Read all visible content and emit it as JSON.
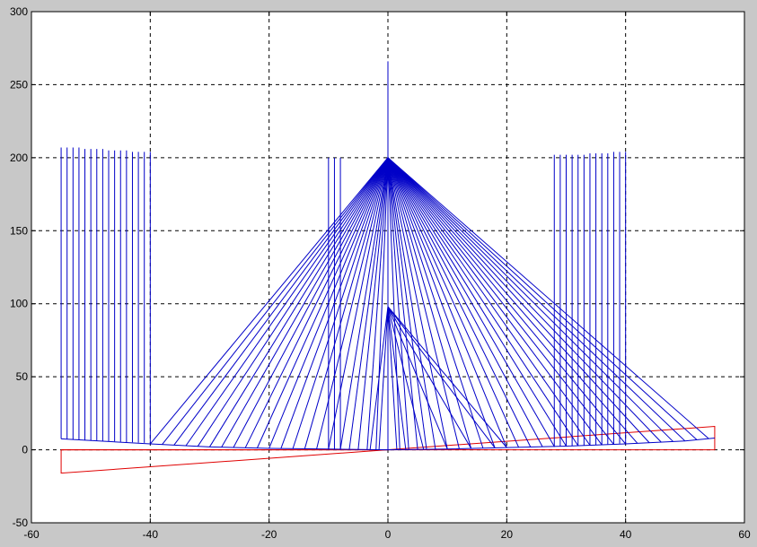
{
  "chart_data": {
    "type": "line",
    "title": "",
    "xlabel": "",
    "ylabel": "",
    "xlim": [
      -60,
      60
    ],
    "ylim": [
      -50,
      300
    ],
    "grid": true,
    "x_ticks": [
      -60,
      -40,
      -20,
      0,
      20,
      40,
      60
    ],
    "y_ticks": [
      -50,
      0,
      50,
      100,
      150,
      200,
      250,
      300
    ],
    "x_tick_labels": [
      "-60",
      "-40",
      "-20",
      "0",
      "20",
      "40",
      "60"
    ],
    "y_tick_labels": [
      "-50",
      "0",
      "50",
      "100",
      "150",
      "200",
      "250",
      "300"
    ],
    "colors": {
      "cables": "#0000c8",
      "outline": "#e00000",
      "axes_bg": "#ffffff",
      "figure_bg": "#c8c8c8"
    },
    "series": [
      {
        "color": "#0000c8",
        "tower": {
          "x": 0,
          "y_bottom": 0,
          "y_top": 266
        },
        "anchor": {
          "x": 0,
          "y": 200
        },
        "secondary_anchor": {
          "x": 0,
          "y": 98
        },
        "left_fan_x": [
          -40,
          -38,
          -36,
          -34,
          -32,
          -30,
          -28,
          -26,
          -24,
          -22,
          -20,
          -18,
          -16,
          -14,
          -12,
          -10,
          -8,
          -6.5,
          -5,
          -3.5,
          -2
        ],
        "right_fan_x": [
          2,
          3.5,
          5,
          6.5,
          8,
          10,
          12,
          14,
          16,
          18,
          20,
          22,
          24,
          26,
          28,
          30,
          32,
          34,
          36,
          38,
          40,
          42,
          44,
          46,
          48,
          50,
          52,
          54
        ],
        "secondary_fan_x": [
          -3,
          -1.5,
          1.5,
          3,
          6,
          10,
          14,
          18,
          20
        ],
        "left_hangers": [
          {
            "x": -55,
            "y_bottom": 7.5,
            "y_top": 207
          },
          {
            "x": -54,
            "y_bottom": 7.3,
            "y_top": 207
          },
          {
            "x": -53,
            "y_bottom": 7.1,
            "y_top": 207
          },
          {
            "x": -52,
            "y_bottom": 6.9,
            "y_top": 207
          },
          {
            "x": -51,
            "y_bottom": 6.7,
            "y_top": 206
          },
          {
            "x": -50,
            "y_bottom": 6.5,
            "y_top": 206
          },
          {
            "x": -49,
            "y_bottom": 6.3,
            "y_top": 206
          },
          {
            "x": -48,
            "y_bottom": 6.1,
            "y_top": 206
          },
          {
            "x": -47,
            "y_bottom": 5.9,
            "y_top": 205
          },
          {
            "x": -46,
            "y_bottom": 5.7,
            "y_top": 205
          },
          {
            "x": -45,
            "y_bottom": 5.5,
            "y_top": 205
          },
          {
            "x": -44,
            "y_bottom": 5.3,
            "y_top": 205
          },
          {
            "x": -43,
            "y_bottom": 5.1,
            "y_top": 204
          },
          {
            "x": -42,
            "y_bottom": 4.9,
            "y_top": 204
          },
          {
            "x": -41,
            "y_bottom": 4.7,
            "y_top": 204
          },
          {
            "x": -40,
            "y_bottom": 4.5,
            "y_top": 204
          }
        ],
        "mid_hangers": [
          {
            "x": -10,
            "y_bottom": 0,
            "y_top": 200
          },
          {
            "x": -9,
            "y_bottom": 0,
            "y_top": 200
          },
          {
            "x": -8,
            "y_bottom": 0,
            "y_top": 200
          }
        ],
        "right_hangers": [
          {
            "x": 28,
            "y_bottom": 2,
            "y_top": 202
          },
          {
            "x": 29,
            "y_bottom": 2.2,
            "y_top": 202
          },
          {
            "x": 30,
            "y_bottom": 2.4,
            "y_top": 202
          },
          {
            "x": 31,
            "y_bottom": 2.6,
            "y_top": 202
          },
          {
            "x": 32,
            "y_bottom": 2.8,
            "y_top": 202
          },
          {
            "x": 33,
            "y_bottom": 3.0,
            "y_top": 202
          },
          {
            "x": 34,
            "y_bottom": 3.2,
            "y_top": 203
          },
          {
            "x": 35,
            "y_bottom": 3.4,
            "y_top": 203
          },
          {
            "x": 36,
            "y_bottom": 3.6,
            "y_top": 203
          },
          {
            "x": 37,
            "y_bottom": 3.8,
            "y_top": 203
          },
          {
            "x": 38,
            "y_bottom": 4.0,
            "y_top": 204
          },
          {
            "x": 39,
            "y_bottom": 4.2,
            "y_top": 204
          },
          {
            "x": 40,
            "y_bottom": 4.4,
            "y_top": 204
          }
        ],
        "deck": [
          [
            -55,
            7.5
          ],
          [
            -40,
            4
          ],
          [
            -30,
            2
          ],
          [
            -20,
            1
          ],
          [
            -10,
            0.5
          ],
          [
            0,
            0
          ],
          [
            10,
            0.5
          ],
          [
            20,
            1.5
          ],
          [
            30,
            2.5
          ],
          [
            40,
            4
          ],
          [
            50,
            6
          ],
          [
            55,
            8
          ]
        ]
      },
      {
        "color": "#e00000",
        "outline_polygon": [
          [
            -55,
            0
          ],
          [
            -55,
            -16
          ],
          [
            55,
            16
          ],
          [
            55,
            0
          ],
          [
            0,
            0
          ],
          [
            -55,
            0
          ]
        ],
        "outline_segment": [
          [
            -55,
            0
          ],
          [
            0,
            0
          ]
        ]
      }
    ]
  },
  "accessibility": {
    "chart_label": "Cable-stayed bridge plot"
  }
}
